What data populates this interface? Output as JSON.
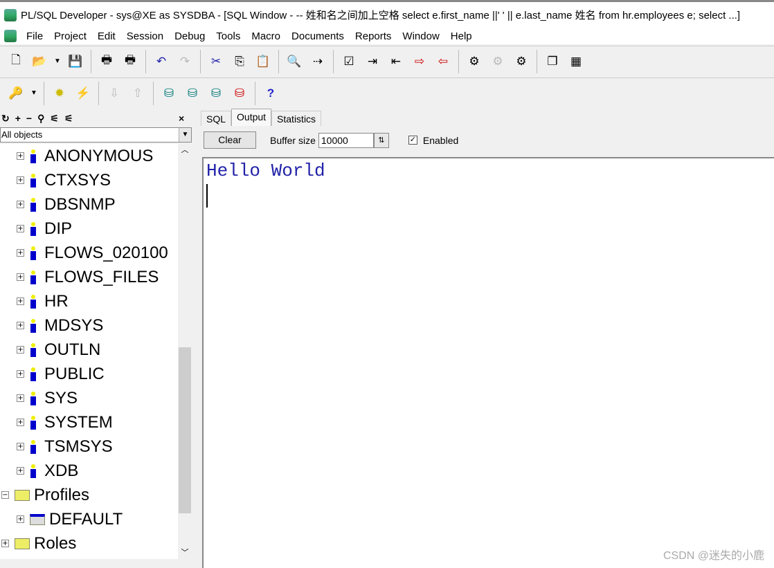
{
  "window": {
    "title": "PL/SQL Developer - sys@XE as SYSDBA - [SQL Window - -- 姓和名之间加上空格 select e.first_name ||' ' || e.last_name 姓名 from hr.employees e; select  ...]"
  },
  "menu": [
    "File",
    "Project",
    "Edit",
    "Session",
    "Debug",
    "Tools",
    "Macro",
    "Documents",
    "Reports",
    "Window",
    "Help"
  ],
  "browser": {
    "filter": "All objects",
    "close": "×",
    "users": [
      "ANONYMOUS",
      "CTXSYS",
      "DBSNMP",
      "DIP",
      "FLOWS_020100",
      "FLOWS_FILES",
      "HR",
      "MDSYS",
      "OUTLN",
      "PUBLIC",
      "SYS",
      "SYSTEM",
      "TSMSYS",
      "XDB"
    ],
    "profiles": {
      "label": "Profiles",
      "children": [
        "DEFAULT"
      ]
    },
    "roles": "Roles"
  },
  "tabs": [
    "SQL",
    "Output",
    "Statistics"
  ],
  "active_tab": "Output",
  "output": {
    "clear": "Clear",
    "buffer_label": "Buffer size",
    "buffer_value": "10000",
    "enabled_label": "Enabled",
    "enabled": true,
    "text": "Hello World"
  },
  "watermark": "CSDN @迷失的小鹿"
}
